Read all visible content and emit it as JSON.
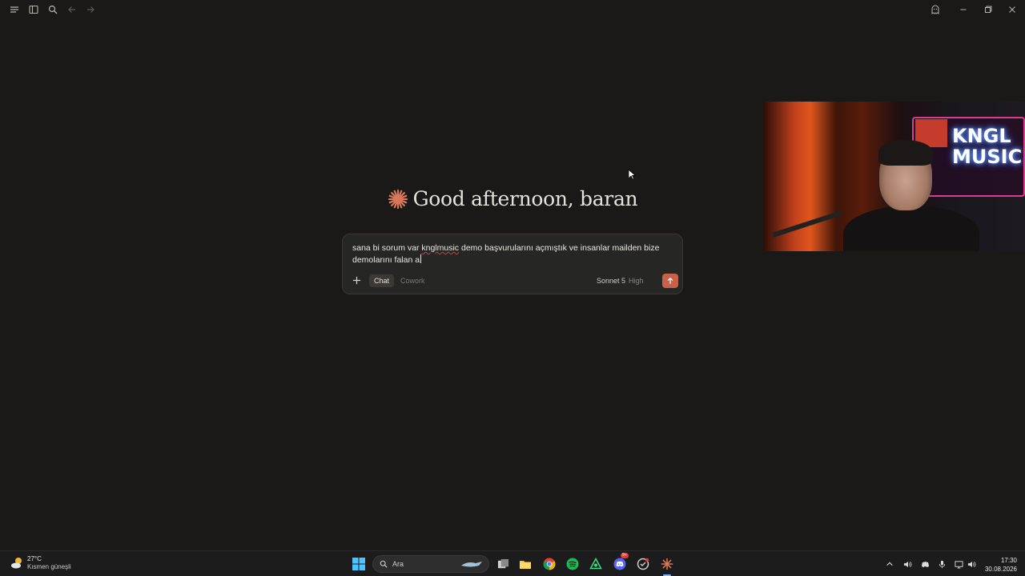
{
  "greeting": {
    "text": "Good afternoon, baran"
  },
  "composer": {
    "text_before": "sana bi sorum var ",
    "text_misspelled": "knglmusic",
    "text_after": " demo başvurularını açmıştık ve insanlar mailden bize demolarını falan a",
    "modes": [
      {
        "label": "Chat",
        "active": true
      },
      {
        "label": "Cowork",
        "active": false
      }
    ],
    "model": "Sonnet 5",
    "effort": "High"
  },
  "webcam": {
    "sign_text": "KNGL MUSIC"
  },
  "taskbar": {
    "weather": {
      "temp": "27°C",
      "desc": "Kısmen güneşli"
    },
    "search_label": "Ara",
    "clock": {
      "time": "17:30",
      "date": "30.08.2026"
    },
    "discord_badge": "9+"
  },
  "colors": {
    "background": "#1a1918",
    "composer_bg": "#262624",
    "accent": "#c8614a",
    "star": "#d9775b"
  }
}
